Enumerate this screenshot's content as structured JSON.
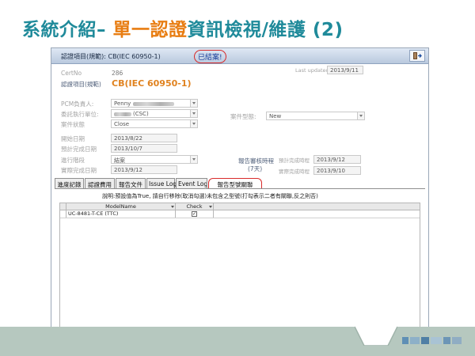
{
  "slide": {
    "title_part1": "系統介紹– ",
    "title_part2": "單一認證",
    "title_part3": "資訊檢視/維護 (2)"
  },
  "window": {
    "title": "認證項目(規範): CB(IEC 60950-1)",
    "status_stamp": "已結案!"
  },
  "form": {
    "certno_label": "CertNo",
    "certno_value": "286",
    "last_updated_label": "Last updated",
    "last_updated_value": "2013/9/11",
    "cert_item_label": "認證項目(規範)",
    "cert_item_value": "CB(IEC 60950-1)",
    "pcm_label": "PCM負責人:",
    "pcm_value": "Penny",
    "agency_label": "委託執行單位:",
    "agency_value": "(CSC)",
    "case_status_label": "案件狀態",
    "case_status_value": "Close",
    "case_type_label": "案件型態:",
    "case_type_value": "New",
    "start_date_label": "開始日期",
    "start_date_value": "2013/8/22",
    "planned_done_label": "預計完成日期",
    "planned_done_value": "2013/10/7",
    "stage_label": "進行階段",
    "stage_value": "結案",
    "actual_done_label": "實際完成日期",
    "actual_done_value": "2013/9/12",
    "report_review_label": "報告審核時程",
    "report_review_days": "(7天)",
    "report_planned_label": "預計完成時程",
    "report_planned_value": "2013/9/12",
    "report_actual_label": "實際完成時程",
    "report_actual_value": "2013/9/10"
  },
  "tabs": [
    {
      "label": "進度記錄"
    },
    {
      "label": "認證費用"
    },
    {
      "label": "報告文件"
    },
    {
      "label": "Issue Log"
    },
    {
      "label": "Event Log"
    },
    {
      "label": "報告型號關聯"
    }
  ],
  "tab_panel": {
    "note": "說明:預設值為True, 請自行移除(取消勾選)未包含之型號(打勾表示二者有關聯,反之則否)",
    "columns": [
      "ModelName",
      "Check"
    ],
    "rows": [
      {
        "model": "UC-8481-T-CE (TTC)",
        "check": true
      }
    ]
  },
  "colors": {
    "title_teal": "#1f8a9a",
    "title_orange": "#e87d12",
    "highlight_red": "#d82a2a",
    "footer_band": "#b6c8bf"
  },
  "icons": {
    "exit_button": "exit-door-icon",
    "dropdown": "chevron-down-icon",
    "checkbox": "checkbox-checked-icon"
  }
}
